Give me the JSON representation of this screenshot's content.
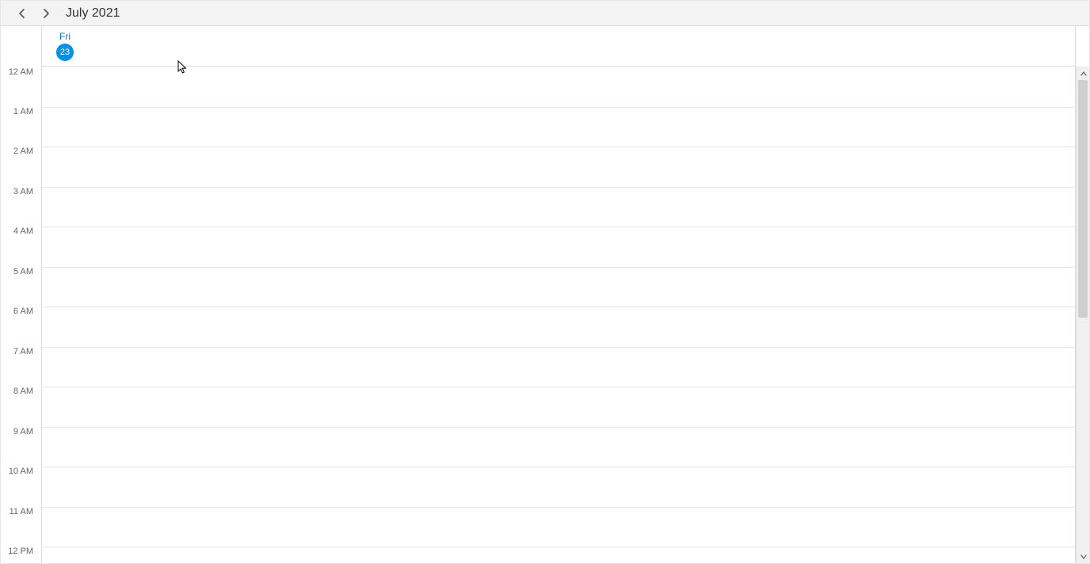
{
  "header": {
    "title": "July 2021"
  },
  "day": {
    "weekday": "Fri",
    "number": "23"
  },
  "hours": [
    "12 AM",
    "1 AM",
    "2 AM",
    "3 AM",
    "4 AM",
    "5 AM",
    "6 AM",
    "7 AM",
    "8 AM",
    "9 AM",
    "10 AM",
    "11 AM",
    "12 PM"
  ],
  "colors": {
    "accent": "#0091ea",
    "link": "#0078d4"
  }
}
